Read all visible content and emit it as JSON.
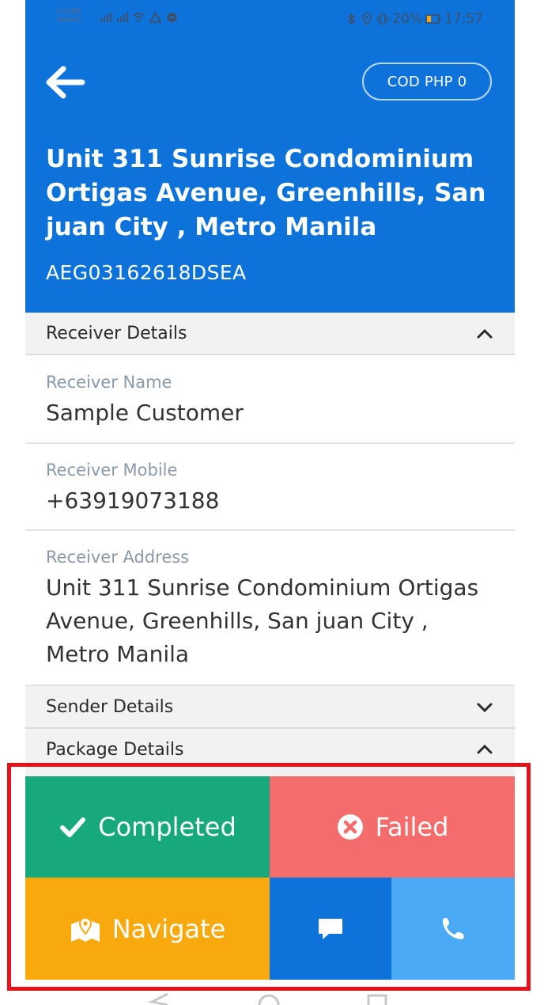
{
  "status_bar": {
    "carrier_line1": "GLOBE",
    "carrier_line2": "SMART",
    "battery": "20%",
    "time": "17:57"
  },
  "header": {
    "cod_label": "COD PHP 0",
    "address": "Unit 311 Sunrise Condominium Ortigas Avenue, Greenhills, San juan City , Metro Manila",
    "tracking_number": "AEG03162618DSEA"
  },
  "receiver": {
    "section_title": "Receiver Details",
    "name_label": "Receiver Name",
    "name_value": "Sample Customer",
    "mobile_label": "Receiver Mobile",
    "mobile_value": "+63919073188",
    "address_label": "Receiver Address",
    "address_value": "Unit 311 Sunrise Condominium Ortigas Avenue, Greenhills, San juan City , Metro Manila"
  },
  "sender": {
    "section_title": "Sender Details"
  },
  "package": {
    "section_title": "Package Details"
  },
  "actions": {
    "completed_label": "Completed",
    "failed_label": "Failed",
    "navigate_label": "Navigate"
  },
  "colors": {
    "header_blue": "#0d72d9",
    "completed_green": "#17a97b",
    "failed_red": "#f46c6c",
    "navigate_orange": "#f7a90e",
    "message_blue": "#0d72d9",
    "call_blue": "#4aaaf6",
    "highlight_red": "#e3121b"
  },
  "icons": {
    "back": "arrow-left-icon",
    "completed": "checkmark-icon",
    "failed": "circle-x-icon",
    "navigate": "map-marker-icon",
    "message": "chat-bubble-icon",
    "call": "phone-icon",
    "expand": "chevron-up-icon",
    "collapse": "chevron-down-icon"
  }
}
